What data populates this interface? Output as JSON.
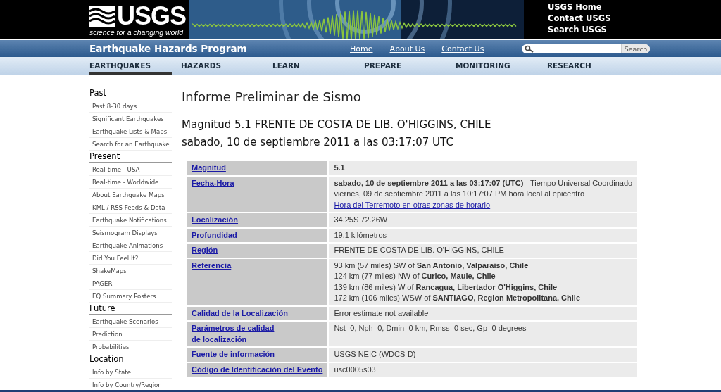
{
  "header": {
    "logo_text": "USGS",
    "logo_tagline": "science for a changing world",
    "links": [
      "USGS Home",
      "Contact USGS",
      "Search USGS"
    ]
  },
  "program_bar": {
    "title": "Earthquake Hazards Program",
    "links": [
      "Home",
      "About Us",
      "Contact Us"
    ],
    "search_button": "Search"
  },
  "nav": [
    {
      "label": "EARTHQUAKES",
      "selected": true
    },
    {
      "label": "HAZARDS",
      "selected": false
    },
    {
      "label": "LEARN",
      "selected": false
    },
    {
      "label": "PREPARE",
      "selected": false
    },
    {
      "label": "MONITORING",
      "selected": false
    },
    {
      "label": "RESEARCH",
      "selected": false
    }
  ],
  "sidebar": [
    {
      "heading": "Past",
      "items": [
        "Past 8-30 days",
        "Significant Earthquakes",
        "Earthquake Lists & Maps",
        "Search for an Earthquake"
      ]
    },
    {
      "heading": "Present",
      "items": [
        "Real-time - USA",
        "Real-time - Worldwide",
        "About Earthquake Maps",
        "KML / RSS Feeds & Data",
        "Earthquake Notifications",
        "Seismogram Displays",
        "Earthquake Animations",
        "Did You Feel It?",
        "ShakeMaps",
        "PAGER",
        "EQ Summary Posters"
      ]
    },
    {
      "heading": "Future",
      "items": [
        "Earthquake Scenarios",
        "Prediction",
        "Probabilities"
      ]
    },
    {
      "heading": "Location",
      "items": [
        "Info by State",
        "Info by Country/Region"
      ]
    }
  ],
  "main": {
    "title": "Informe Preliminar de Sismo",
    "subtitle": "Magnitud 5.1 FRENTE DE COSTA DE LIB. O'HIGGINS, CHILE",
    "date": "sabado, 10 de septiembre 2011 a las 03:17:07 UTC"
  },
  "table": [
    {
      "label": [
        "Magnitud"
      ],
      "lines": [
        {
          "kind": "bold",
          "text": "5.1"
        }
      ]
    },
    {
      "label": [
        "Fecha-Hora"
      ],
      "lines": [
        {
          "kind": "text",
          "text": "**sabado, 10 de septiembre 2011 a las 03:17:07 (UTC)** - Tiempo Universal Coordinado"
        },
        {
          "kind": "text",
          "text": "viernes, 09 de septiembre 2011 a las 10:17:07 PM hora local al epicentro"
        },
        {
          "kind": "link",
          "text": "Hora del Terremoto en otras zonas de horario"
        }
      ]
    },
    {
      "label": [
        "Localización"
      ],
      "lines": [
        {
          "kind": "text",
          "text": "34.25S 72.26W"
        }
      ]
    },
    {
      "label": [
        "Profundidad"
      ],
      "lines": [
        {
          "kind": "text",
          "text": "19.1 kilómetros"
        }
      ]
    },
    {
      "label": [
        "Región"
      ],
      "lines": [
        {
          "kind": "text",
          "text": "FRENTE DE COSTA DE LIB. O'HIGGINS, CHILE"
        }
      ]
    },
    {
      "label": [
        "Referencia"
      ],
      "lines": [
        {
          "kind": "text",
          "text": "93 km (57 miles) SW of **San Antonio, Valparaiso, Chile**"
        },
        {
          "kind": "text",
          "text": "124 km (77 miles) NW of **Curico, Maule, Chile**"
        },
        {
          "kind": "text",
          "text": "139 km (86 miles) W of **Rancagua, Libertador O'Higgins, Chile**"
        },
        {
          "kind": "text",
          "text": "172 km (106 miles) WSW of **SANTIAGO, Region Metropolitana, Chile**"
        }
      ]
    },
    {
      "label": [
        "Calidad de la Localización"
      ],
      "lines": [
        {
          "kind": "text",
          "text": "Error estimate not available"
        }
      ]
    },
    {
      "label": [
        "Parámetros de calidad",
        "de localización"
      ],
      "lines": [
        {
          "kind": "text",
          "text": "Nst=0, Nph=0, Dmin=0 km, Rmss=0 sec, Gp=0 degrees"
        }
      ]
    },
    {
      "label": [
        "Fuente de información"
      ],
      "lines": [
        {
          "kind": "text",
          "text": "USGS NEIC (WDCS-D)"
        }
      ]
    },
    {
      "label": [
        "Código de Identificación del Evento"
      ],
      "lines": [
        {
          "kind": "text",
          "text": "usc0005s03"
        }
      ]
    }
  ]
}
